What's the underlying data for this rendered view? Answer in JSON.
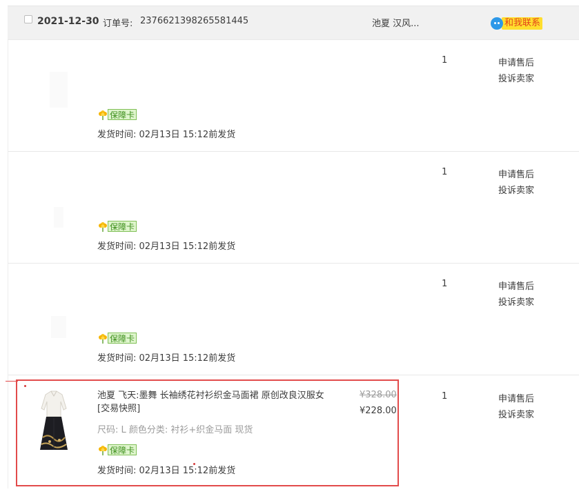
{
  "order": {
    "date": "2021-12-30",
    "order_no_label": "订单号:",
    "order_no": "2376621398265581445",
    "shop_name": "池夏 汉风...",
    "contact_label": "和我联系",
    "items": [
      {
        "quantity": "1",
        "guarantee_label": "保障卡",
        "ship_time": "发货时间: 02月13日 15:12前发货",
        "after_sale_label": "申请售后",
        "complain_label": "投诉卖家"
      },
      {
        "quantity": "1",
        "guarantee_label": "保障卡",
        "ship_time": "发货时间: 02月13日 15:12前发货",
        "after_sale_label": "申请售后",
        "complain_label": "投诉卖家"
      },
      {
        "quantity": "1",
        "guarantee_label": "保障卡",
        "ship_time": "发货时间: 02月13日 15:12前发货",
        "after_sale_label": "申请售后",
        "complain_label": "投诉卖家"
      },
      {
        "title": "池夏 飞天:墨舞 长袖绣花衬衫织金马面裙 原创改良汉服女",
        "snapshot_label": "[交易快照]",
        "sku": "尺码: L  颜色分类: 衬衫+织金马面 现货",
        "price_original": "¥328.00",
        "price_current": "¥228.00",
        "quantity": "1",
        "guarantee_label": "保障卡",
        "ship_time": "发货时间: 02月13日 15:12前发货",
        "after_sale_label": "申请售后",
        "complain_label": "投诉卖家"
      }
    ]
  },
  "colors": {
    "header_bg": "#f1f1f1",
    "contact_bg": "#ffde2e",
    "contact_text": "#e3421a",
    "guarantee_border": "#7fbf55",
    "annotation_red": "#e24a4a"
  },
  "icons": {
    "contact": "chat-bubble-icon",
    "guarantee": "yellow-flower-icon",
    "checkbox": "checkbox-icon"
  }
}
